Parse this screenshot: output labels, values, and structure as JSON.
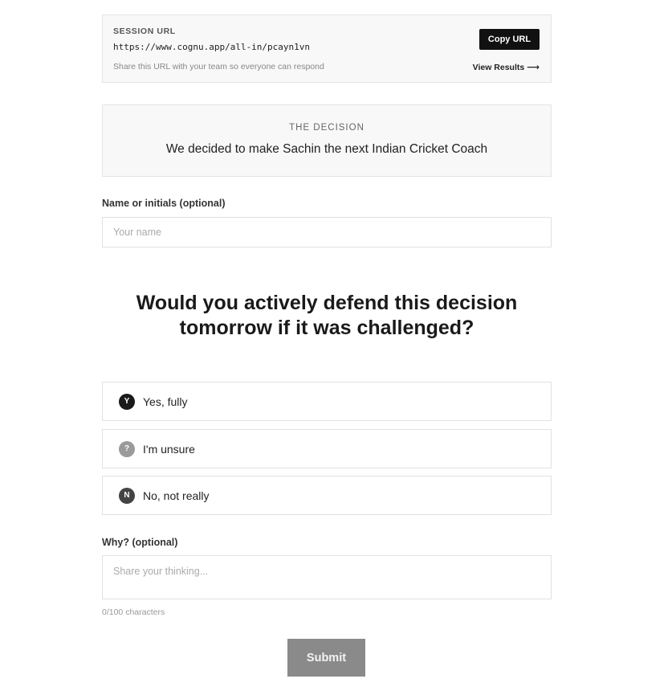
{
  "session": {
    "label": "SESSION URL",
    "url": "https://www.cognu.app/all-in/pcayn1vn",
    "hint": "Share this URL with your team so everyone can respond",
    "copy_button": "Copy URL",
    "view_results": "View Results",
    "view_results_arrow": "⟶"
  },
  "decision": {
    "label": "THE DECISION",
    "text": "We decided to make Sachin the next Indian Cricket Coach"
  },
  "name_field": {
    "label": "Name or initials (optional)",
    "placeholder": "Your name",
    "value": ""
  },
  "question": {
    "line1": "Would you actively defend this decision",
    "line2": "tomorrow if it was challenged?"
  },
  "options": [
    {
      "badge": "Y",
      "label": "Yes, fully",
      "color": "#1a1a1a"
    },
    {
      "badge": "?",
      "label": "I'm unsure",
      "color": "#9a9a9a"
    },
    {
      "badge": "N",
      "label": "No, not really",
      "color": "#444444"
    }
  ],
  "why_field": {
    "label": "Why? (optional)",
    "placeholder": "Share your thinking...",
    "value": "",
    "char_count": "0/100 characters"
  },
  "submit": {
    "label": "Submit",
    "color": "#8a8a8a"
  }
}
